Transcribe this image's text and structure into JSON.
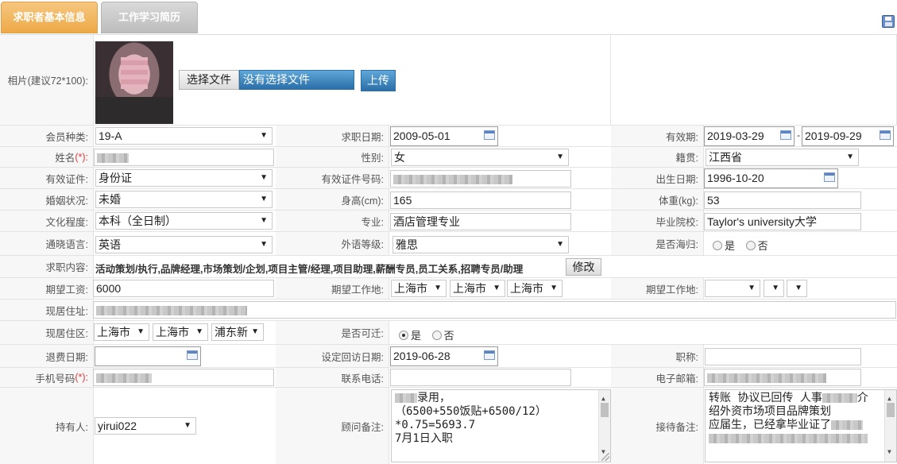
{
  "tabs": [
    "求职者基本信息",
    "工作学习简历"
  ],
  "photo": {
    "label": "相片(建议72*100):",
    "choose_btn": "选择文件",
    "no_file_text": "没有选择文件",
    "upload_btn": "上传"
  },
  "labels": {
    "member_type": "会员种类:",
    "job_date": "求职日期:",
    "valid_period": "有效期:",
    "name": "姓名",
    "gender": "性别:",
    "native_place": "籍贯:",
    "id_type": "有效证件:",
    "id_number": "有效证件号码:",
    "birth_date": "出生日期:",
    "marital": "婚姻状况:",
    "height": "身高(cm):",
    "weight": "体重(kg):",
    "education": "文化程度:",
    "major": "专业:",
    "school": "毕业院校:",
    "language": "通晓语言:",
    "language_level": "外语等级:",
    "returnee": "是否海归:",
    "job_content": "求职内容:",
    "expected_salary": "期望工资:",
    "expected_location": "期望工作地:",
    "expected_location2": "期望工作地:",
    "current_address": "现居住址:",
    "current_area": "现居住区:",
    "relocate": "是否可迁:",
    "refund_date": "退费日期:",
    "callback_date": "设定回访日期:",
    "title": "职称:",
    "mobile": "手机号码",
    "phone": "联系电话:",
    "email": "电子邮箱:",
    "holder": "持有人:",
    "advisor_note": "顾问备注:",
    "reception_note": "接待备注:"
  },
  "required_mark": "(*):",
  "values": {
    "member_type": "19-A",
    "job_date": "2009-05-01",
    "valid_from": "2019-03-29",
    "valid_sep": "-",
    "valid_to": "2019-09-29",
    "gender": "女",
    "native_place": "江西省",
    "id_type": "身份证",
    "birth_date": "1996-10-20",
    "marital": "未婚",
    "height": "165",
    "weight": "53",
    "education": "本科（全日制）",
    "major": "酒店管理专业",
    "school": "Taylor's university大学",
    "language": "英语",
    "language_level": "雅思",
    "returnee_yes": "是",
    "returnee_no": "否",
    "job_content": "活动策划/执行,品牌经理,市场策划/企划,项目主管/经理,项目助理,薪酬专员,员工关系,招聘专员/助理",
    "modify_btn": "修改",
    "expected_salary": "6000",
    "loc1_province": "上海市",
    "loc1_city": "上海市",
    "loc1_district": "上海市",
    "area_province": "上海市",
    "area_city": "上海市",
    "area_district": "浦东新",
    "relocate_yes": "是",
    "relocate_no": "否",
    "callback_date": "2019-06-28",
    "holder": "yirui022",
    "advisor_note": [
      "录用，",
      "（6500+550饭贴+6500/12）",
      "*0.75=5693.7",
      "7月1日入职"
    ],
    "reception_note": [
      "转账  协议已回传  人事",
      "介",
      "绍外资市场项目品牌策划",
      "应届生，已经拿毕业证了"
    ]
  }
}
